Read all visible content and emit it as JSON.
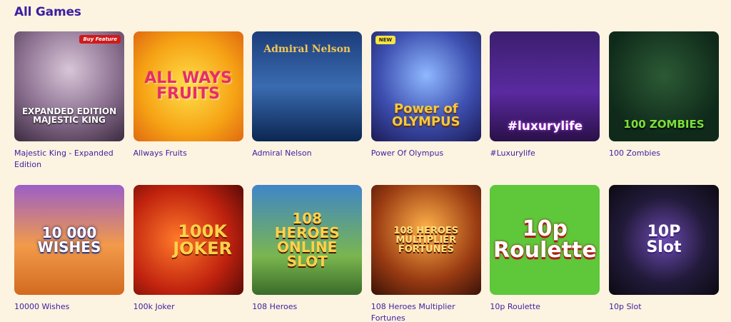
{
  "section_title": "All Games",
  "games": [
    {
      "name": "Majestic King - Expanded Edition",
      "logo": "EXPANDED EDITION\nMAJESTIC KING",
      "badge": "Buy Feature"
    },
    {
      "name": "Allways Fruits",
      "logo": "ALL WAYS\nFRUITS"
    },
    {
      "name": "Admiral Nelson",
      "logo": "Admiral Nelson"
    },
    {
      "name": "Power Of Olympus",
      "logo": "Power of\nOLYMPUS",
      "badge": "NEW"
    },
    {
      "name": "#Luxurylife",
      "logo": "#luxurylife"
    },
    {
      "name": "100 Zombies",
      "logo": "100 ZOMBIES"
    },
    {
      "name": "10000 Wishes",
      "logo": "10 000\nWISHES"
    },
    {
      "name": "100k Joker",
      "logo": "100K\nJOKER"
    },
    {
      "name": "108 Heroes",
      "logo": "108\nHEROES\nONLINE SLOT"
    },
    {
      "name": "108 Heroes Multiplier Fortunes",
      "logo": "108 HEROES\nMULTIPLIER\nFORTUNES"
    },
    {
      "name": "10p Roulette",
      "logo": "10p\nRoulette"
    },
    {
      "name": "10p Slot",
      "logo": "10P\nSlot"
    }
  ]
}
